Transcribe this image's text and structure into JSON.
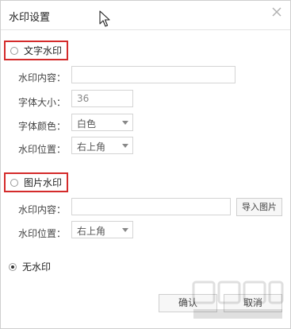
{
  "dialog": {
    "title": "水印设置"
  },
  "text_watermark": {
    "label": "文字水印",
    "content_label": "水印内容：",
    "content_value": "",
    "font_size_label": "字体大小：",
    "font_size_value": "36",
    "font_color_label": "字体颜色：",
    "font_color_value": "白色",
    "position_label": "水印位置：",
    "position_value": "右上角"
  },
  "image_watermark": {
    "label": "图片水印",
    "content_label": "水印内容：",
    "content_value": "",
    "import_button": "导入图片",
    "position_label": "水印位置：",
    "position_value": "右上角"
  },
  "no_watermark": {
    "label": "无水印",
    "selected": true
  },
  "buttons": {
    "confirm": "确认",
    "cancel": "取消"
  },
  "icons": {
    "close": "close-icon",
    "cursor": "mouse-pointer-icon"
  }
}
